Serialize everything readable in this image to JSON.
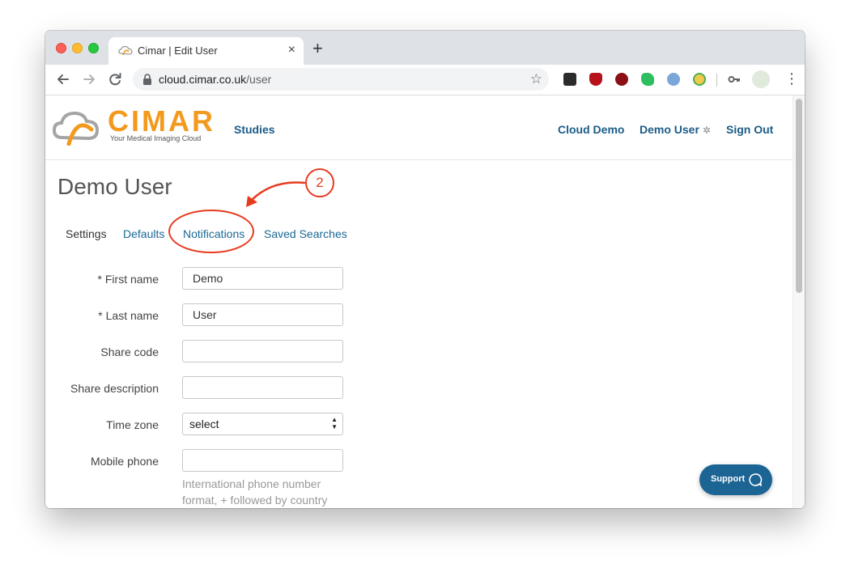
{
  "browser": {
    "tab_title": "Cimar | Edit User",
    "tab_close": "×",
    "new_tab": "+",
    "url_host": "cloud.cimar.co.uk",
    "url_path": "/user",
    "bookmark_star": "☆",
    "menu": "⋮"
  },
  "site": {
    "logo_text": "CIMAR",
    "logo_tagline": "Your Medical Imaging Cloud",
    "brand_color": "#f39a1e",
    "link_color": "#1b5c87",
    "nav": {
      "studies": "Studies",
      "cloud_demo": "Cloud Demo",
      "demo_user": "Demo User",
      "sign_out": "Sign Out"
    }
  },
  "page": {
    "title": "Demo User",
    "subnav": [
      {
        "label": "Settings",
        "active": true
      },
      {
        "label": "Defaults",
        "active": false
      },
      {
        "label": "Notifications",
        "active": false
      },
      {
        "label": "Saved Searches",
        "active": false
      }
    ],
    "form": {
      "first_name": {
        "label": "* First name",
        "value": "Demo"
      },
      "last_name": {
        "label": "* Last name",
        "value": "User"
      },
      "share_code": {
        "label": "Share code",
        "value": ""
      },
      "share_description": {
        "label": "Share description",
        "value": ""
      },
      "time_zone": {
        "label": "Time zone",
        "value": "select"
      },
      "mobile_phone": {
        "label": "Mobile phone",
        "value": ""
      },
      "mobile_help": "International phone number format, + followed by country"
    }
  },
  "support": {
    "label": "Support"
  },
  "annotation": {
    "step_number": "2",
    "color": "#e83a1f"
  }
}
